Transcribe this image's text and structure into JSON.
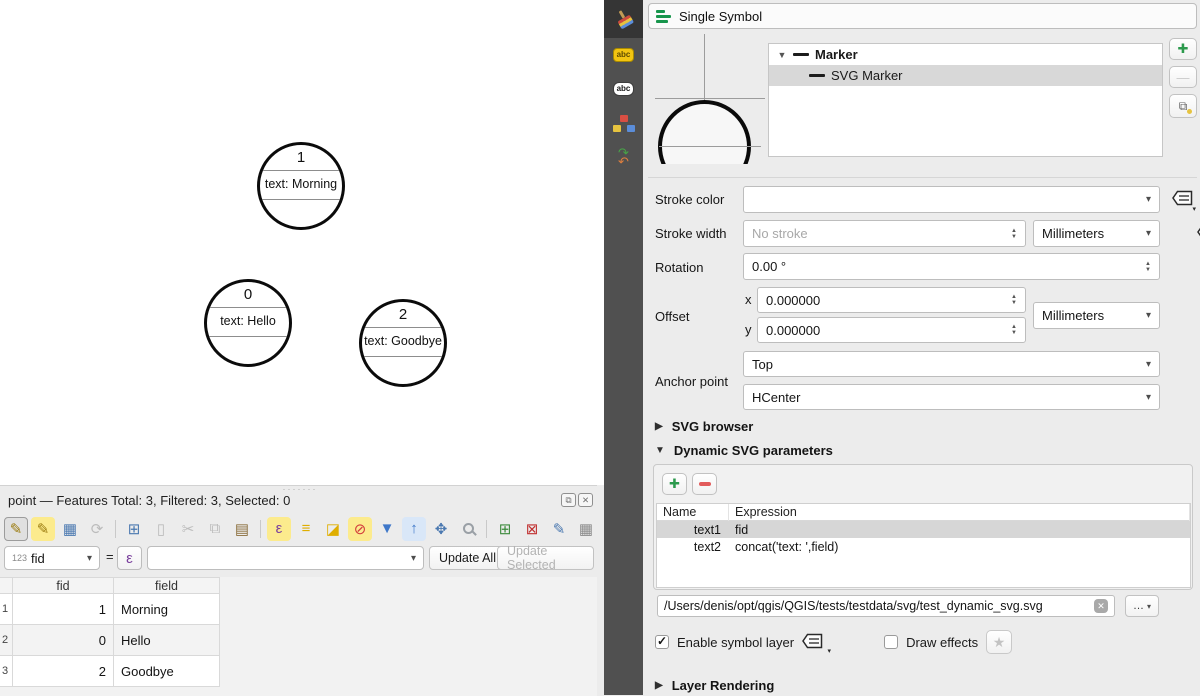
{
  "colors": {
    "accent_green": "#17954c",
    "panel_bg": "#ececec",
    "dock_tabbar_bg": "#505050",
    "selection_gray": "#d8d8d8",
    "marker_stroke": "#0b0b0b"
  },
  "map": {
    "features": [
      {
        "id": "1",
        "label": "text: Morning"
      },
      {
        "id": "0",
        "label": "text: Hello"
      },
      {
        "id": "2",
        "label": "text: Goodbye"
      }
    ]
  },
  "attribute_table": {
    "title": "point — Features Total: 3, Filtered: 3, Selected: 0",
    "window_icons": {
      "float": "⧉",
      "close": "✕"
    },
    "toolbar": [
      {
        "name": "toggle-editing-icon",
        "glyph": "✎",
        "color": "#9c7c10",
        "active": true
      },
      {
        "name": "multiedit-icon",
        "glyph": "✎",
        "color": "#9c7c10",
        "bg": "#fceb8d"
      },
      {
        "name": "save-edits-icon",
        "glyph": "▦",
        "color": "#4a78b0"
      },
      {
        "name": "refresh-icon",
        "glyph": "⟳",
        "color": "#bcbcbc"
      },
      {
        "sep": true
      },
      {
        "name": "add-feature-icon",
        "glyph": "⊞",
        "color": "#4a78b0"
      },
      {
        "name": "delete-selected-icon",
        "glyph": "▯",
        "color": "#bcbcbc"
      },
      {
        "name": "cut-icon",
        "glyph": "✂",
        "color": "#bcbcbc"
      },
      {
        "name": "copy-icon",
        "glyph": "⧉",
        "color": "#bcbcbc"
      },
      {
        "name": "paste-icon",
        "glyph": "▤",
        "color": "#8a6d3b"
      },
      {
        "sep": true
      },
      {
        "name": "select-by-expression-icon",
        "glyph": "ε",
        "color": "#7a3f9d",
        "bg": "#fceb8d"
      },
      {
        "name": "select-all-icon",
        "glyph": "≡",
        "color": "#dfae00"
      },
      {
        "name": "invert-selection-icon",
        "glyph": "◪",
        "color": "#dfae00"
      },
      {
        "name": "deselect-all-icon",
        "glyph": "⊘",
        "color": "#d23b3b",
        "bg": "#fceb8d"
      },
      {
        "name": "filter-form-icon",
        "glyph": "▼",
        "color": "#3f78c9"
      },
      {
        "name": "move-selection-top-icon",
        "glyph": "↑",
        "color": "#3f78c9",
        "bg": "#d9e7f8"
      },
      {
        "name": "pan-to-selection-icon",
        "glyph": "✥",
        "color": "#4a78b0"
      },
      {
        "name": "zoom-to-selection-icon",
        "shape": "magnifier"
      },
      {
        "sep": true
      },
      {
        "name": "new-field-icon",
        "glyph": "⊞",
        "color": "#3c8a3c"
      },
      {
        "name": "delete-field-icon",
        "glyph": "⊠",
        "color": "#c03030"
      },
      {
        "name": "edit-field-icon",
        "glyph": "✎",
        "color": "#4a78b0"
      },
      {
        "name": "conditional-formatting-icon",
        "glyph": "▦",
        "color": "#8a8a8a"
      },
      {
        "name": "toolbar-overflow",
        "glyph": "»",
        "color": "#333333"
      }
    ],
    "field_selector": {
      "type_badge": "123",
      "value": "fid"
    },
    "equals_sign": "=",
    "epsilon_button": "ε",
    "expression_value": "",
    "update_all_label": "Update All",
    "update_selected_label": "Update Selected",
    "columns": [
      "fid",
      "field"
    ],
    "rows": [
      {
        "num": "1",
        "fid": "1",
        "field": "Morning"
      },
      {
        "num": "2",
        "fid": "0",
        "field": "Hello"
      },
      {
        "num": "3",
        "fid": "2",
        "field": "Goodbye"
      }
    ]
  },
  "style_panel": {
    "header": "Single Symbol",
    "dock_tabs": [
      {
        "name": "layer-symbology-tab",
        "active": true
      },
      {
        "name": "layer-labels-tab",
        "active": false
      },
      {
        "name": "layer-callouts-tab",
        "active": false
      },
      {
        "name": "layer-diagram-tab",
        "active": false
      },
      {
        "name": "layer-history-tab",
        "active": false
      }
    ],
    "tree": {
      "parent": "Marker",
      "child": "SVG Marker"
    },
    "fields": {
      "stroke_color_label": "Stroke color",
      "stroke_width_label": "Stroke width",
      "stroke_width_placeholder": "No stroke",
      "unit": "Millimeters",
      "rotation_label": "Rotation",
      "rotation_value": "0.00 °",
      "offset_label": "Offset",
      "offset_x_label": "x",
      "offset_x_value": "0.000000",
      "offset_y_label": "y",
      "offset_y_value": "0.000000",
      "anchor_label": "Anchor point",
      "anchor_vertical": "Top",
      "anchor_horizontal": "HCenter"
    },
    "sections": {
      "svg_browser": "SVG browser",
      "dynamic_params": "Dynamic SVG parameters",
      "layer_rendering": "Layer Rendering"
    },
    "params_table": {
      "columns": [
        "Name",
        "Expression"
      ],
      "rows": [
        {
          "name": "text1",
          "expression": "fid"
        },
        {
          "name": "text2",
          "expression": "concat('text: ',field)"
        }
      ]
    },
    "svg_path": "/Users/denis/opt/qgis/QGIS/tests/testdata/svg/test_dynamic_svg.svg",
    "browse_label": "…",
    "enable_symbol_layer_label": "Enable symbol layer",
    "draw_effects_label": "Draw effects",
    "star_glyph": "★"
  }
}
